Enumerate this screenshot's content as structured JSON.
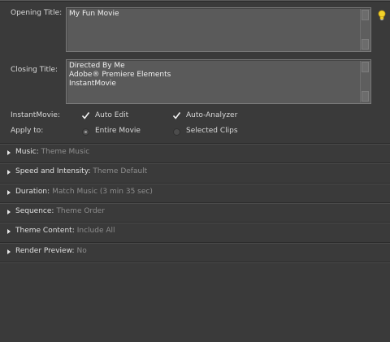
{
  "opening_title": {
    "label": "Opening Title:",
    "value": "My Fun Movie"
  },
  "closing_title": {
    "label": "Closing Title:",
    "lines": [
      "Directed By Me",
      "Adobe® Premiere Elements",
      "InstantMovie"
    ]
  },
  "instant_movie": {
    "label": "InstantMovie:",
    "auto_edit": {
      "label": "Auto Edit",
      "checked": true
    },
    "auto_analyzer": {
      "label": "Auto-Analyzer",
      "checked": true
    }
  },
  "apply_to": {
    "label": "Apply to:",
    "options": [
      {
        "label": "Entire Movie",
        "selected": true
      },
      {
        "label": "Selected Clips",
        "selected": false
      }
    ]
  },
  "sections": [
    {
      "label": "Music:",
      "value": "Theme Music"
    },
    {
      "label": "Speed and Intensity:",
      "value": "Theme Default"
    },
    {
      "label": "Duration:",
      "value": "Match Music (3 min 35 sec)"
    },
    {
      "label": "Sequence:",
      "value": "Theme Order"
    },
    {
      "label": "Theme Content:",
      "value": "Include All"
    },
    {
      "label": "Render Preview:",
      "value": "No"
    }
  ],
  "icons": {
    "tip": "lightbulb-icon",
    "expand": "triangle-right-icon",
    "check": "checkmark-icon"
  },
  "colors": {
    "background": "#3a3a3a",
    "field": "#5a5a5a",
    "muted_value": "#8e8e8e",
    "bulb": "#f0d020"
  }
}
